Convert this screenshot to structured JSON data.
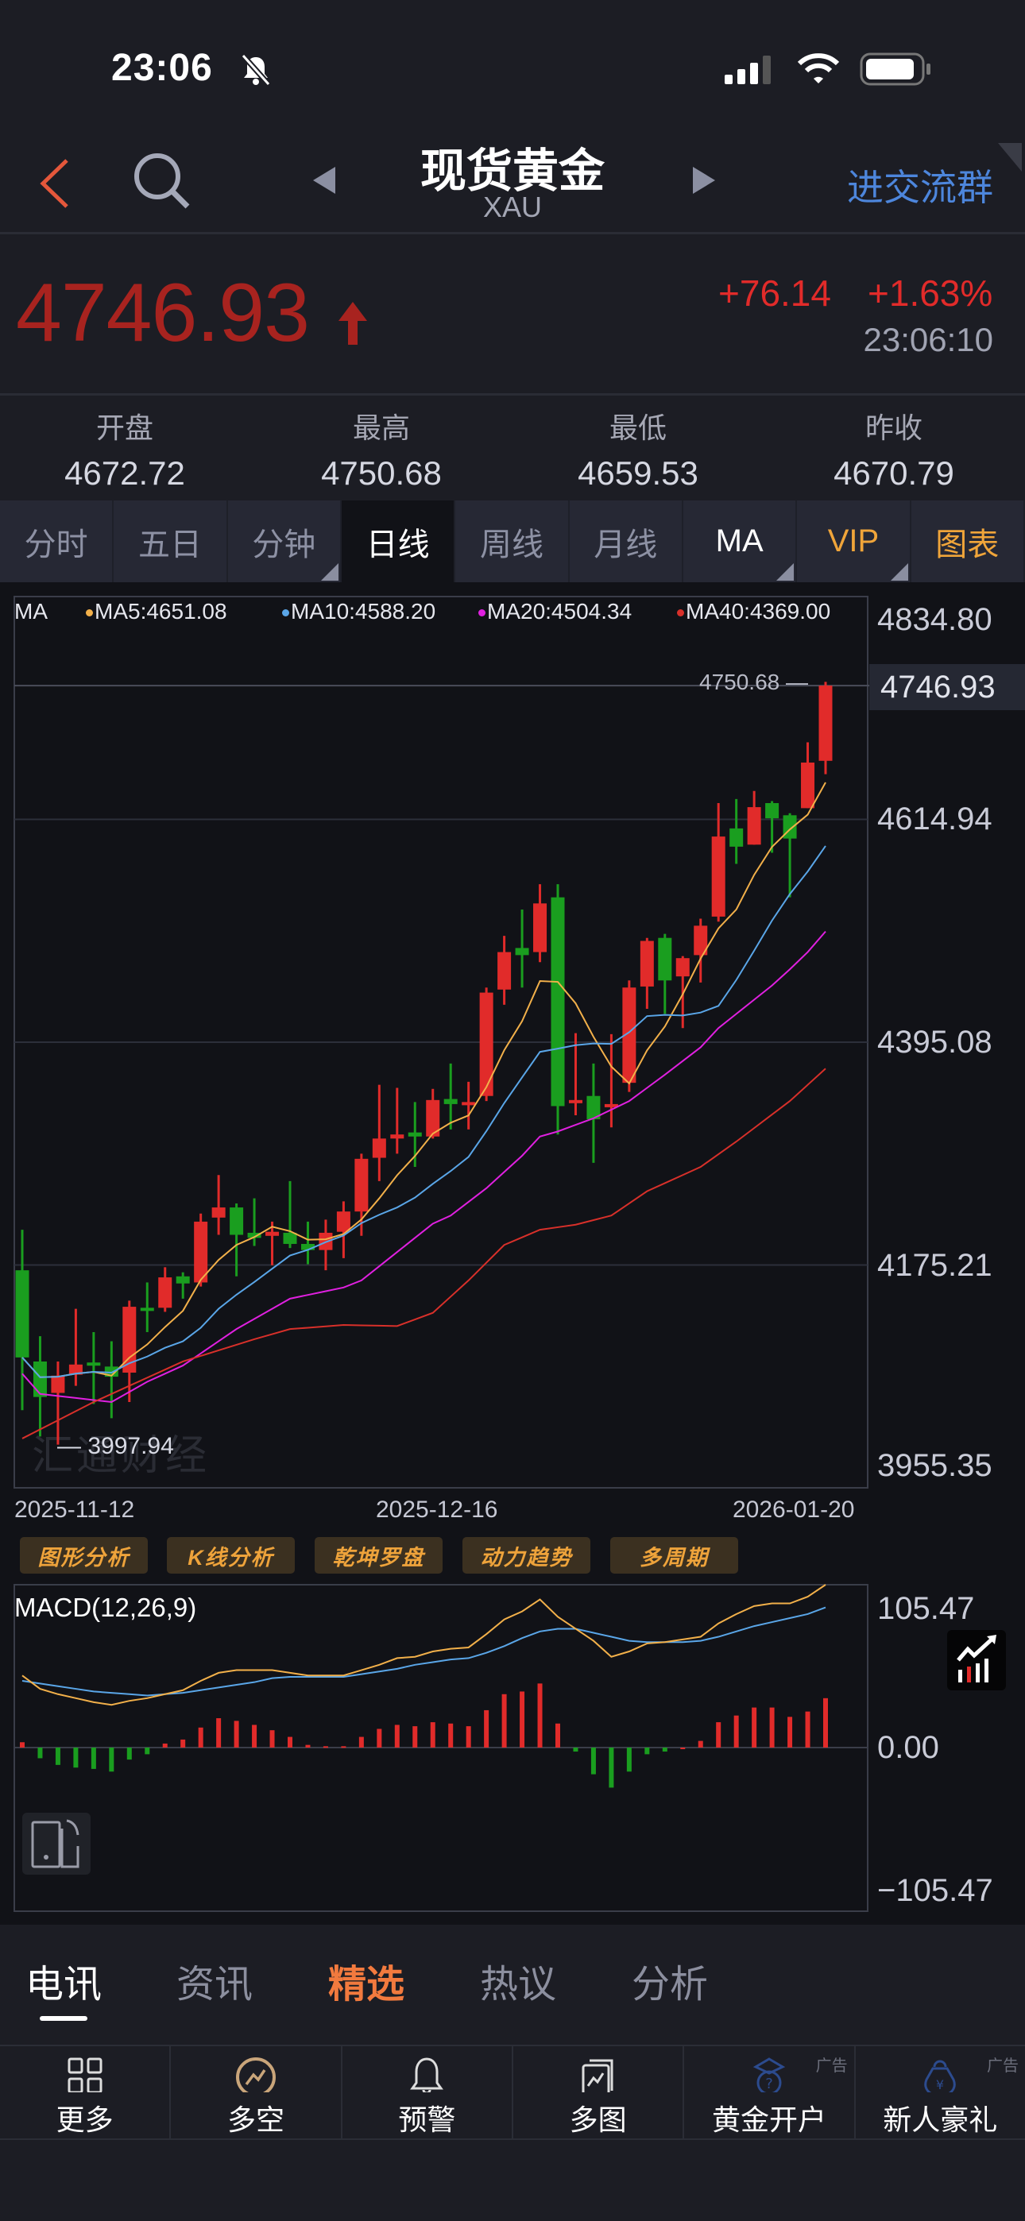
{
  "status_bar": {
    "time": "23:06"
  },
  "header": {
    "title": "现货黄金",
    "symbol": "XAU",
    "group_link": "进交流群"
  },
  "quote": {
    "price": "4746.93",
    "change": "+76.14",
    "change_pct": "+1.63%",
    "time": "23:06:10",
    "up_color": "#e12b2a",
    "down_color": "#1a9e1f"
  },
  "ohlc": [
    {
      "label": "开盘",
      "value": "4672.72"
    },
    {
      "label": "最高",
      "value": "4750.68"
    },
    {
      "label": "最低",
      "value": "4659.53"
    },
    {
      "label": "昨收",
      "value": "4670.79"
    }
  ],
  "period_tabs": [
    {
      "label": "分时"
    },
    {
      "label": "五日"
    },
    {
      "label": "分钟",
      "dropdown": true
    },
    {
      "label": "日线",
      "active": true
    },
    {
      "label": "周线"
    },
    {
      "label": "月线"
    },
    {
      "label": "MA",
      "dropdown": true
    },
    {
      "label": "VIP",
      "dropdown": true
    },
    {
      "label": "图表"
    }
  ],
  "main_chart": {
    "legend": {
      "ma": "MA",
      "ma5": "MA5:4651.08",
      "ma10": "MA10:4588.20",
      "ma20": "MA20:4504.34",
      "ma40": "MA40:4369.00"
    },
    "axis_labels": [
      "4834.80",
      "4614.94",
      "4395.08",
      "4175.21",
      "3955.35"
    ],
    "current_price_tag": "4746.93",
    "high_marker": "4750.68 —",
    "low_marker": "— 3997.94",
    "watermark": "汇通财经",
    "dates": [
      "2025-11-12",
      "2025-12-16",
      "2026-01-20"
    ]
  },
  "tools": [
    "图形分析",
    "K线分析",
    "乾坤罗盘",
    "动力趋势",
    "多周期"
  ],
  "macd": {
    "label": "MACD(12,26,9)",
    "axis_labels": [
      "105.47",
      "0.00",
      "−105.47"
    ]
  },
  "news_tabs": [
    {
      "label": "电讯",
      "active": true
    },
    {
      "label": "资讯"
    },
    {
      "label": "精选",
      "highlight": true
    },
    {
      "label": "热议"
    },
    {
      "label": "分析"
    }
  ],
  "bottom_toolbar": [
    {
      "label": "更多",
      "icon": "grid-icon"
    },
    {
      "label": "多空",
      "icon": "long-short-icon"
    },
    {
      "label": "预警",
      "icon": "bell-icon"
    },
    {
      "label": "多图",
      "icon": "multi-chart-icon"
    },
    {
      "label": "黄金开户",
      "icon": "gold-account-icon",
      "ad": "广告"
    },
    {
      "label": "新人豪礼",
      "icon": "gift-bag-icon",
      "ad": "广告"
    }
  ],
  "chart_data": [
    {
      "type": "candlestick",
      "title": "现货黄金 XAU 日线",
      "ylim": [
        3955.35,
        4834.8
      ],
      "y_ticks": [
        4834.8,
        4614.94,
        4395.08,
        4175.21,
        3955.35
      ],
      "x_labels": [
        "2025-11-12",
        "2025-12-16",
        "2026-01-20"
      ],
      "grid": true,
      "ohlc": [
        [
          4170,
          4210,
          4032,
          4084
        ],
        [
          4080,
          4105,
          4006,
          4045
        ],
        [
          4049,
          4080,
          3997.94,
          4066
        ],
        [
          4067,
          4132,
          4056,
          4077
        ],
        [
          4079,
          4109,
          4038,
          4077
        ],
        [
          4075,
          4100,
          4024,
          4065
        ],
        [
          4069,
          4140,
          4040,
          4134
        ],
        [
          4133,
          4158,
          4109,
          4131
        ],
        [
          4133,
          4173,
          4129,
          4163
        ],
        [
          4164,
          4168,
          4142,
          4157
        ],
        [
          4158,
          4226,
          4154,
          4218
        ],
        [
          4222,
          4264,
          4205,
          4232
        ],
        [
          4232,
          4236,
          4164,
          4205
        ],
        [
          4207,
          4241,
          4194,
          4202
        ],
        [
          4204,
          4218,
          4175,
          4208
        ],
        [
          4207,
          4258,
          4192,
          4196
        ],
        [
          4196,
          4218,
          4176,
          4190
        ],
        [
          4190,
          4220,
          4170,
          4207
        ],
        [
          4208,
          4238,
          4182,
          4228
        ],
        [
          4228,
          4285,
          4204,
          4280
        ],
        [
          4281,
          4353,
          4258,
          4300
        ],
        [
          4300,
          4350,
          4285,
          4304
        ],
        [
          4306,
          4336,
          4272,
          4302
        ],
        [
          4302,
          4349,
          4300,
          4338
        ],
        [
          4339,
          4374,
          4309,
          4334
        ],
        [
          4334,
          4356,
          4309,
          4336
        ],
        [
          4342,
          4449,
          4337,
          4444
        ],
        [
          4447,
          4500,
          4432,
          4484
        ],
        [
          4488,
          4526,
          4449,
          4481
        ],
        [
          4484,
          4551,
          4474,
          4532
        ],
        [
          4538,
          4551,
          4304,
          4332
        ],
        [
          4336,
          4404,
          4323,
          4338
        ],
        [
          4342,
          4374,
          4276,
          4319
        ],
        [
          4332,
          4403,
          4311,
          4334
        ],
        [
          4355,
          4456,
          4346,
          4449
        ],
        [
          4450,
          4498,
          4428,
          4495
        ],
        [
          4498,
          4502,
          4423,
          4456
        ],
        [
          4460,
          4480,
          4409,
          4478
        ],
        [
          4481,
          4517,
          4454,
          4510
        ],
        [
          4519,
          4631,
          4514,
          4598
        ],
        [
          4606,
          4635,
          4571,
          4588
        ],
        [
          4590,
          4643,
          4590,
          4627
        ],
        [
          4631,
          4633,
          4582,
          4616
        ],
        [
          4619,
          4621,
          4538,
          4596
        ],
        [
          4626,
          4691,
          4626,
          4671
        ],
        [
          4672.72,
          4750.68,
          4659.53,
          4746.93
        ]
      ],
      "ma_series": [
        {
          "name": "MA5",
          "color": "#f2b04a",
          "period": 5
        },
        {
          "name": "MA10",
          "color": "#5aa6e8",
          "period": 10
        },
        {
          "name": "MA20",
          "color": "#e020e0",
          "anchors": [
            [
              1,
              4068
            ],
            [
              2,
              4048
            ],
            [
              5,
              4042
            ],
            [
              6,
              4040
            ],
            [
              8,
              4060
            ],
            [
              10,
              4076
            ],
            [
              13,
              4112
            ],
            [
              16,
              4142
            ],
            [
              19,
              4153
            ],
            [
              20,
              4160
            ],
            [
              22,
              4188
            ],
            [
              24,
              4216
            ],
            [
              25,
              4224
            ],
            [
              27,
              4251
            ],
            [
              29,
              4283
            ],
            [
              30,
              4302
            ],
            [
              31,
              4307
            ],
            [
              33,
              4320
            ],
            [
              35,
              4337
            ],
            [
              37,
              4363
            ],
            [
              39,
              4390
            ],
            [
              40,
              4409
            ],
            [
              43,
              4451
            ],
            [
              44,
              4467
            ],
            [
              45,
              4484
            ],
            [
              46,
              4504.34
            ]
          ]
        },
        {
          "name": "MA40",
          "color": "#d8302a",
          "anchors": [
            [
              1,
              4004
            ],
            [
              5,
              4040
            ],
            [
              10,
              4080
            ],
            [
              14,
              4102
            ],
            [
              16,
              4112
            ],
            [
              19,
              4116
            ],
            [
              22,
              4115
            ],
            [
              24,
              4128
            ],
            [
              26,
              4160
            ],
            [
              28,
              4195
            ],
            [
              30,
              4210
            ],
            [
              32,
              4215
            ],
            [
              34,
              4224
            ],
            [
              36,
              4248
            ],
            [
              39,
              4272
            ],
            [
              41,
              4297
            ],
            [
              44,
              4337
            ],
            [
              46,
              4369.0
            ]
          ]
        }
      ]
    },
    {
      "type": "macd",
      "title": "MACD(12,26,9)",
      "ylim": [
        -122,
        122
      ],
      "y_ticks": [
        105.47,
        0,
        -105.47
      ],
      "hist": [
        4,
        -8,
        -13,
        -15,
        -16,
        -18,
        -9,
        -5,
        3,
        6,
        15,
        22,
        20,
        17,
        13,
        8,
        2,
        1,
        1,
        8,
        14,
        17,
        16,
        19,
        18,
        16,
        28,
        40,
        42,
        48,
        18,
        -3,
        -20,
        -30,
        -18,
        -5,
        -3,
        0,
        5,
        19,
        24,
        30,
        30,
        23,
        27,
        37
      ],
      "dif": [
        54,
        44,
        40,
        37,
        34,
        32,
        35,
        37,
        40,
        43,
        50,
        56,
        58,
        58,
        58,
        56,
        54,
        54,
        54,
        58,
        62,
        67,
        68,
        72,
        74,
        75,
        85,
        96,
        102,
        111,
        98,
        89,
        80,
        68,
        72,
        78,
        79,
        81,
        83,
        93,
        100,
        106,
        108,
        108,
        113,
        123
      ],
      "dea": [
        50,
        48,
        46,
        44,
        42,
        41,
        40,
        39,
        40,
        41,
        43,
        45,
        47,
        49,
        52,
        53,
        53,
        53,
        53,
        55,
        57,
        59,
        62,
        64,
        66,
        67,
        71,
        76,
        82,
        87,
        89,
        89,
        86,
        83,
        80,
        79,
        79,
        79,
        80,
        83,
        87,
        91,
        94,
        97,
        100,
        105
      ],
      "dif_color": "#f2b04a",
      "dea_color": "#5aa6e8"
    }
  ]
}
